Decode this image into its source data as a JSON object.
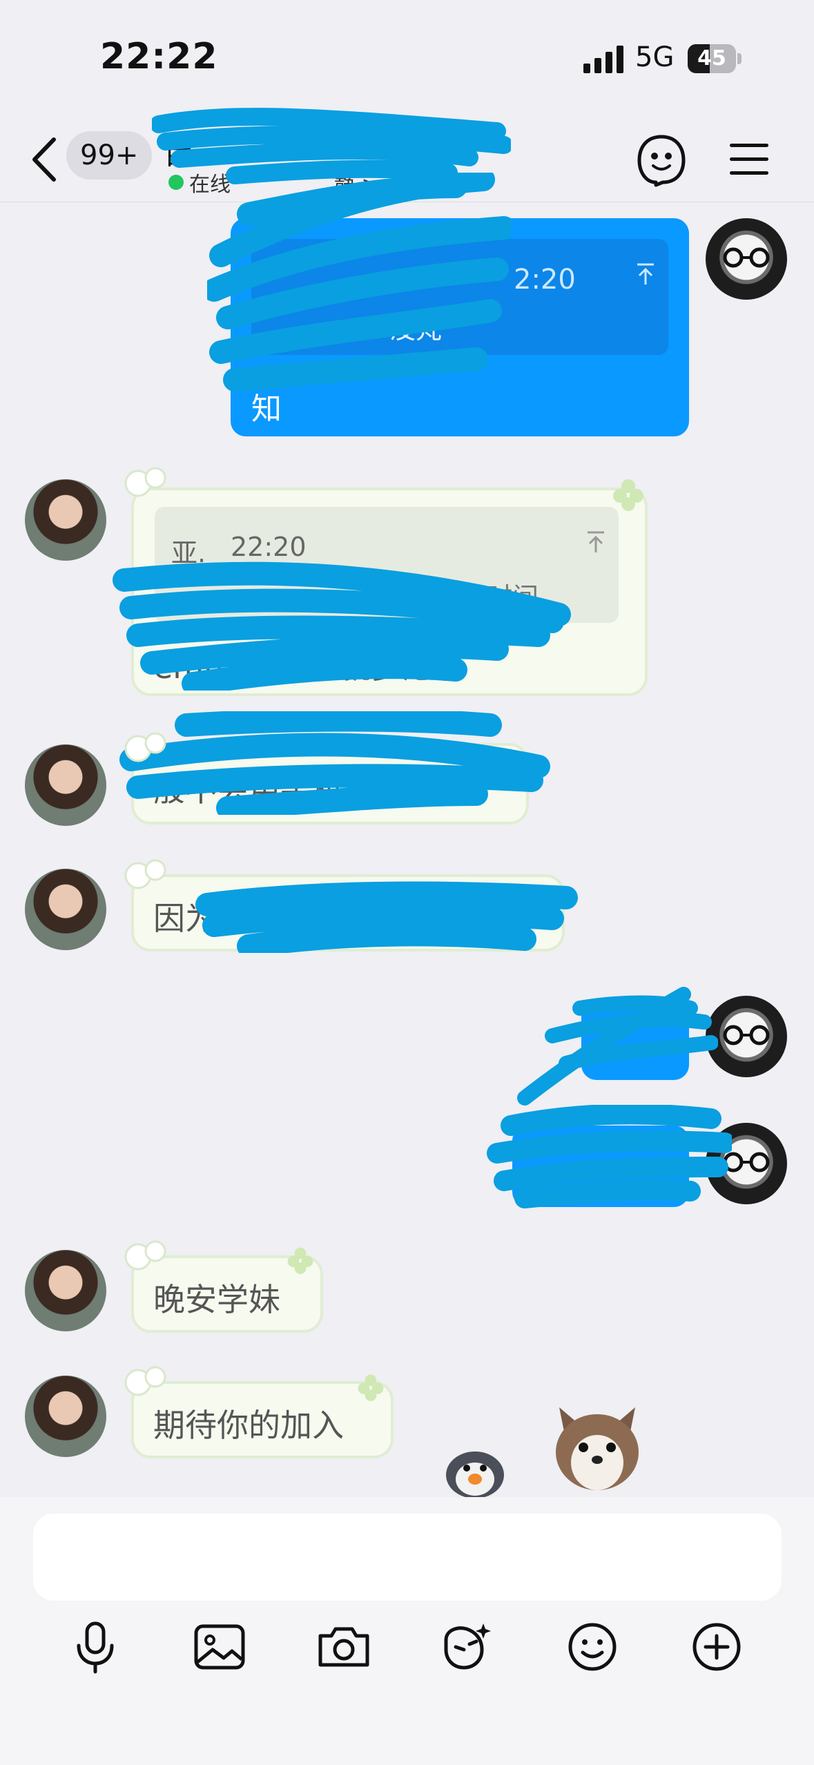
{
  "status_bar": {
    "time": "22:22",
    "network": "5G",
    "battery_text": "45",
    "battery_level": 0.45
  },
  "header": {
    "unread_count": "99+",
    "contact_name": "亩",
    "online_status": "在线",
    "status_suffix": "静 >"
  },
  "messages": {
    "m1": {
      "quote_name": "",
      "quote_time": "2:20",
      "quote_text": "没梵",
      "reply_text": "知"
    },
    "m2": {
      "quote_name": "亚.",
      "quote_time": "22:20",
      "quote_text": "时间",
      "reply_text": "emmm 这个就多虑了"
    },
    "m3": {
      "text": "般不会用手机的时间的"
    },
    "m4": {
      "text": "因为"
    },
    "m7": {
      "text": "晚安学妹"
    },
    "m8": {
      "text": "期待你的加入"
    }
  },
  "input": {
    "placeholder": ""
  },
  "toolbar": [
    "microphone-icon",
    "image-icon",
    "camera-icon",
    "sticker-icon",
    "emoji-icon",
    "add-icon"
  ],
  "colors": {
    "outgoing_bubble": "#0a99ff",
    "incoming_bubble": "#f6faef",
    "scribble": "#0a9fe0",
    "online": "#22c55e"
  }
}
